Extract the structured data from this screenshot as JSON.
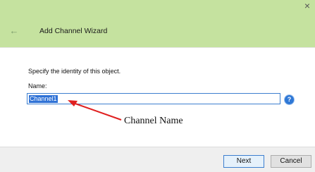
{
  "header": {
    "title": "Add Channel Wizard",
    "back_icon": "back-arrow-icon",
    "close_icon": "close-icon",
    "close_glyph": "×",
    "back_glyph": "←",
    "background": "#c5e29f"
  },
  "form": {
    "prompt": "Specify the identity of this object.",
    "name_label": "Name:",
    "name_value": "Channel1",
    "help_glyph": "?"
  },
  "footer": {
    "next_label": "Next",
    "cancel_label": "Cancel"
  },
  "annotation": {
    "text": "Channel Name",
    "arrow_color": "#e02020"
  }
}
